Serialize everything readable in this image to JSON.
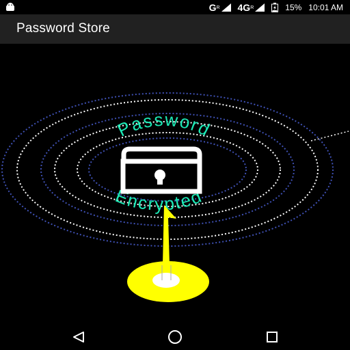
{
  "status_bar": {
    "notification_icon": "android-icon",
    "network_1_label": "G",
    "network_1_sup": "R",
    "network_2_label": "4G",
    "network_2_sup": "R",
    "battery_percent": "15%",
    "time": "10:01 AM",
    "signal_icon": "signal-icon",
    "battery_icon": "battery-charging-icon"
  },
  "app_bar": {
    "title": "Password Store"
  },
  "logo": {
    "top_text": "Password",
    "bottom_text": "Encrypted",
    "lock_icon": "padlock-icon",
    "colors": {
      "text": "#1de9b6",
      "lock": "#ffffff",
      "key": "#ffff00",
      "ring_blue": "#3f51b5",
      "ring_white": "#ffffff"
    }
  },
  "nav_bar": {
    "back_icon": "back-triangle-icon",
    "home_icon": "home-circle-icon",
    "recents_icon": "recents-square-icon"
  }
}
